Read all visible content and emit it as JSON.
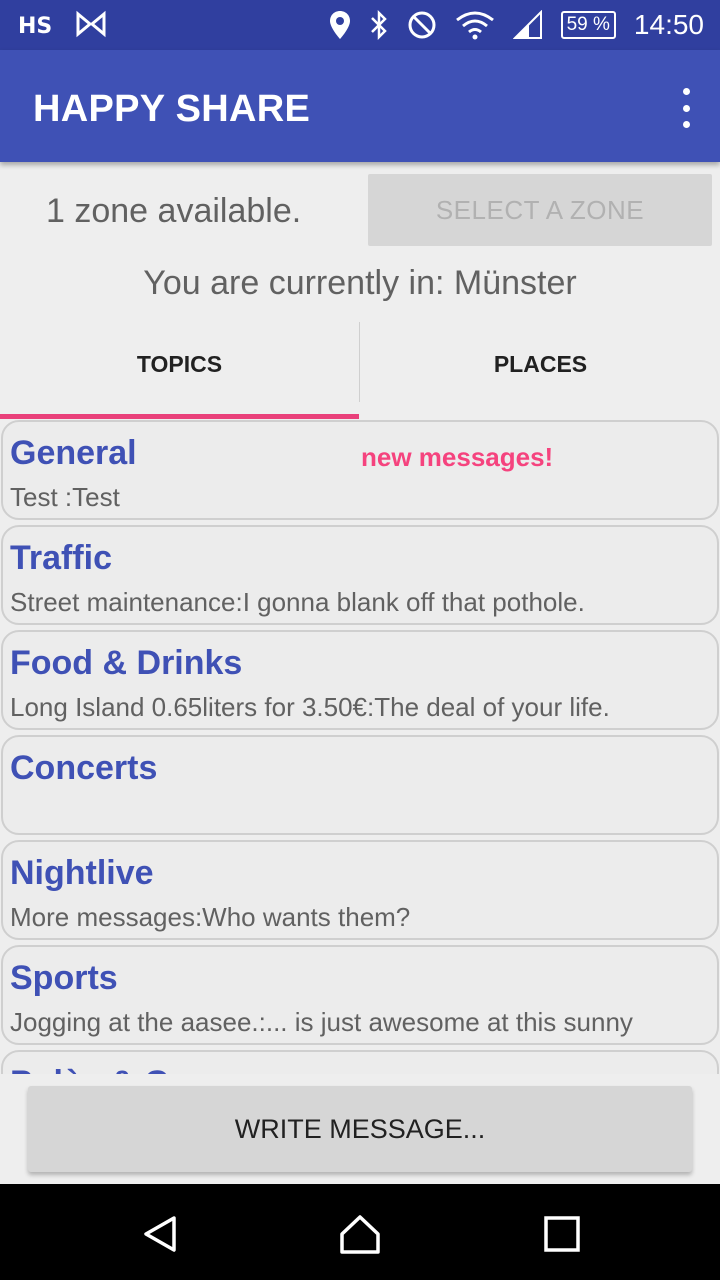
{
  "status_bar": {
    "time": "14:50",
    "battery": "59 %",
    "left_icons": [
      "hs-app-icon",
      "media-icon"
    ],
    "right_icons": [
      "location-icon",
      "bluetooth-icon",
      "dnd-icon",
      "wifi-icon",
      "signal-icon"
    ]
  },
  "app_bar": {
    "title": "HAPPY SHARE",
    "overflow_icon": "more-vert-icon",
    "color": "#3f51b5",
    "status_color": "#303f9f"
  },
  "zone": {
    "available_text": "1 zone available.",
    "select_button": "SELECT A ZONE",
    "current_text": "You are currently in: Münster"
  },
  "tabs": [
    {
      "label": "TOPICS",
      "selected": true
    },
    {
      "label": "PLACES",
      "selected": false
    }
  ],
  "topics": [
    {
      "title": "General",
      "preview": "Test :Test",
      "badge": "new messages!"
    },
    {
      "title": "Traffic",
      "preview": "Street maintenance:I gonna blank off that pothole."
    },
    {
      "title": "Food & Drinks",
      "preview": "Long Island 0.65liters for 3.50€:The deal of your life."
    },
    {
      "title": "Concerts",
      "preview": ""
    },
    {
      "title": "Nightlive",
      "preview": "More messages:Who wants them?"
    },
    {
      "title": "Sports",
      "preview": "Jogging at the aasee.:... is just awesome at this sunny"
    },
    {
      "title": "Polès & Co",
      "preview": ""
    }
  ],
  "write_button": "WRITE MESSAGE...",
  "accent_color": "#e9407a",
  "nav_bar": {
    "icons": [
      "back-icon",
      "home-icon",
      "recents-icon"
    ]
  }
}
